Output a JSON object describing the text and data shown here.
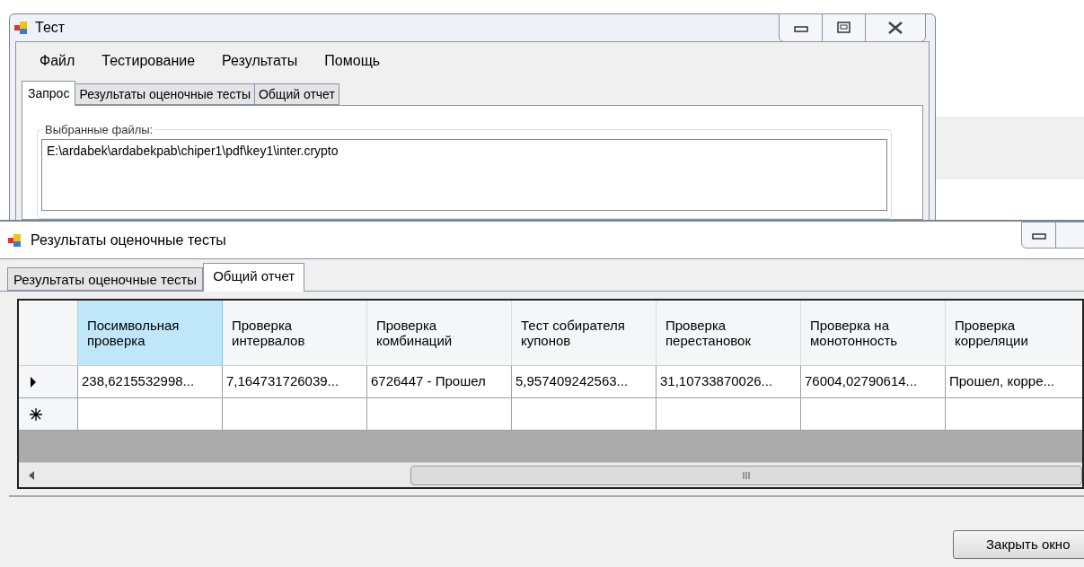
{
  "back_window": {
    "title": "Тест",
    "menu": [
      "Файл",
      "Тестирование",
      "Результаты",
      "Помощь"
    ],
    "tabs": [
      {
        "label": "Запрос",
        "selected": true
      },
      {
        "label": "Результаты оценочные тесты",
        "selected": false
      },
      {
        "label": "Общий отчет",
        "selected": false
      }
    ],
    "files_group": {
      "label": "Выбранные файлы:",
      "value": "E:\\ardabek\\ardabekpab\\chiper1\\pdf\\key1\\inter.crypto"
    }
  },
  "front_window": {
    "title": "Результаты оценочные тесты",
    "tabs": [
      {
        "label": "Результаты оценочные тесты",
        "selected": false
      },
      {
        "label": "Общий отчет",
        "selected": true
      }
    ],
    "table": {
      "columns": [
        {
          "label": "Посимвольная проверка",
          "selected": true
        },
        {
          "label": "Проверка интервалов",
          "selected": false
        },
        {
          "label": "Проверка комбинаций",
          "selected": false
        },
        {
          "label": "Тест собирателя купонов",
          "selected": false
        },
        {
          "label": "Проверка перестановок",
          "selected": false
        },
        {
          "label": "Проверка на монотонность",
          "selected": false
        },
        {
          "label": "Проверка корреляции",
          "selected": false
        }
      ],
      "rows": [
        {
          "kind": "current",
          "cells": [
            "238,6215532998...",
            "7,164731726039...",
            "6726447 - Прошел",
            "5,957409242563...",
            "31,10733870026...",
            "76004,02790614...",
            "Прошел, корре..."
          ]
        },
        {
          "kind": "new",
          "cells": []
        }
      ]
    },
    "close_button": "Закрыть окно"
  }
}
